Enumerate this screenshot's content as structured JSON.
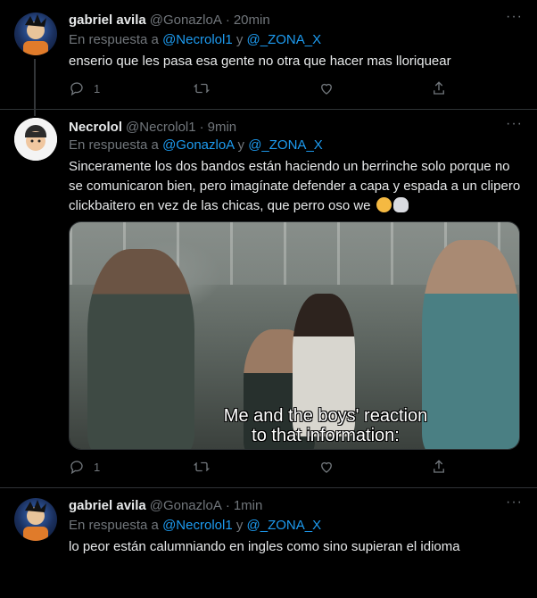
{
  "tweets": [
    {
      "name": "gabriel avila",
      "handle": "@GonazloA",
      "time": "20min",
      "reply_prefix": "En respuesta a ",
      "reply_mention_1": "@Necrolol1",
      "reply_conj": " y ",
      "reply_mention_2": "@_ZONA_X",
      "text": "enserio que les pasa esa gente no otra que hacer mas lloriquear",
      "replies": "1",
      "more": "···"
    },
    {
      "name": "Necrolol",
      "handle": "@Necrolol1",
      "time": "9min",
      "reply_prefix": "En respuesta a ",
      "reply_mention_1": "@GonazloA",
      "reply_conj": " y ",
      "reply_mention_2": "@_ZONA_X",
      "text": "Sinceramente los dos bandos están haciendo un berrinche solo porque no se comunicaron bien, pero imagínate defender a capa y espada a un clipero clickbaitero en vez de las chicas, que perro oso we",
      "media_caption_line1": "Me and the boys' reaction",
      "media_caption_line2": "to that information:",
      "replies": "1",
      "more": "···"
    },
    {
      "name": "gabriel avila",
      "handle": "@GonazloA",
      "time": "1min",
      "reply_prefix": "En respuesta a ",
      "reply_mention_1": "@Necrolol1",
      "reply_conj": " y ",
      "reply_mention_2": "@_ZONA_X",
      "text": "lo peor están calumniando en ingles como sino supieran el idioma",
      "more": "···"
    }
  ],
  "separator": "·",
  "icons": [
    "reply-icon",
    "retweet-icon",
    "like-icon",
    "share-icon",
    "more-icon"
  ],
  "colors": {
    "background": "#000000",
    "text": "#e7e9ea",
    "muted": "#71767b",
    "link": "#1d9bf0",
    "border": "#2f3336"
  }
}
